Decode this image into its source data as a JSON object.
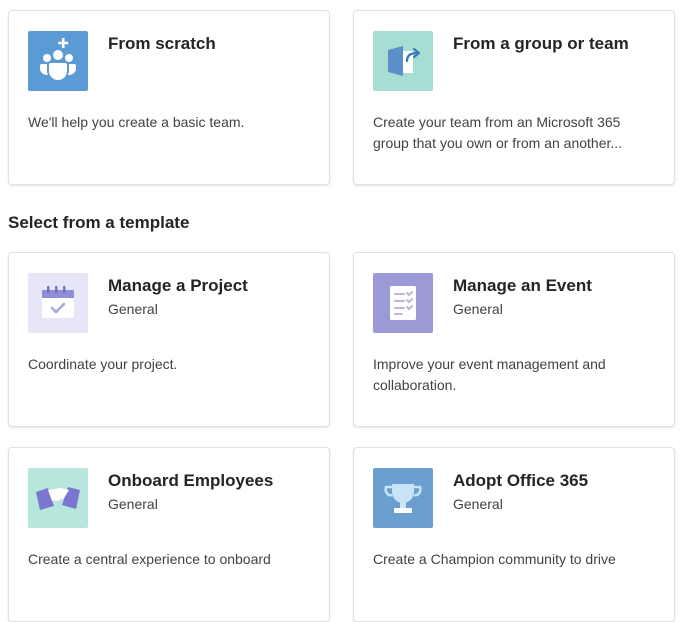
{
  "create_options": [
    {
      "title": "From scratch",
      "description": "We'll help you create a basic team.",
      "icon": "people-add-icon",
      "tile_color": "#5b9bd5"
    },
    {
      "title": "From a group or team",
      "description": "Create your team from an Microsoft 365 group that you own or from an another...",
      "icon": "group-arrow-icon",
      "tile_color": "#a7ddd2"
    }
  ],
  "section": {
    "heading": "Select from a template"
  },
  "templates": [
    {
      "title": "Manage a Project",
      "subtitle": "General",
      "description": "Coordinate your project.",
      "icon": "calendar-check-icon",
      "tile_color": "#e6e6f7"
    },
    {
      "title": "Manage an Event",
      "subtitle": "General",
      "description": "Improve your event management and collaboration.",
      "icon": "clipboard-checklist-icon",
      "tile_color": "#9b99d6"
    },
    {
      "title": "Onboard Employees",
      "subtitle": "General",
      "description": "Create a central experience to onboard",
      "icon": "handshake-icon",
      "tile_color": "#b7e6dd"
    },
    {
      "title": "Adopt Office 365",
      "subtitle": "General",
      "description": "Create a Champion community to drive",
      "icon": "trophy-icon",
      "tile_color": "#6a9fd0"
    }
  ]
}
